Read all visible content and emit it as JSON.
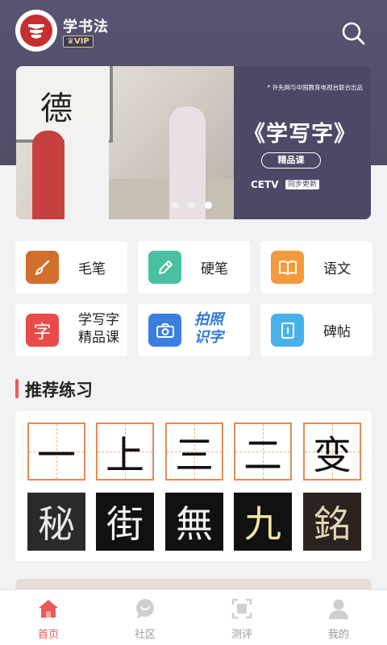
{
  "header": {
    "app_title": "学书法",
    "vip_badge": "VIP",
    "logo_icon": "logo-icon",
    "search_icon": "search-icon"
  },
  "banner": {
    "board_char": "德",
    "small_text": "* 许先网与中国教育电视台联合出品",
    "title": "《学写字》",
    "tag": "精品课",
    "cetv": "CETV",
    "cetv_sub": "同步更新",
    "pages": 3,
    "active_page": 3
  },
  "tiles": [
    {
      "label": "毛笔",
      "icon": "brush-icon",
      "color": "#d0702c"
    },
    {
      "label": "硬笔",
      "icon": "pen-icon",
      "color": "#4bbfa2"
    },
    {
      "label": "语文",
      "icon": "book-icon",
      "color": "#f39a3c"
    },
    {
      "label_line1": "学写字",
      "label_line2": "精品课",
      "icon": "zi-icon",
      "icon_char": "字",
      "color": "#e94a4a"
    },
    {
      "label_line1": "拍照",
      "label_line2": "识字",
      "icon": "camera-icon",
      "color": "#3a7fe0"
    },
    {
      "label": "碑帖",
      "icon": "stele-icon",
      "color": "#47b2ea"
    }
  ],
  "section": {
    "title": "推荐练习"
  },
  "practice": {
    "grid_chars": [
      "一",
      "上",
      "三",
      "二",
      "变"
    ],
    "rubbing_chars": [
      "秘",
      "街",
      "無",
      "九",
      "銘"
    ]
  },
  "tabbar": {
    "items": [
      {
        "label": "首页",
        "icon": "home-icon",
        "active": true
      },
      {
        "label": "社区",
        "icon": "chat-bubble-icon",
        "active": false
      },
      {
        "label": "测评",
        "icon": "scan-icon",
        "active": false
      },
      {
        "label": "我的",
        "icon": "user-icon",
        "active": false
      }
    ]
  }
}
